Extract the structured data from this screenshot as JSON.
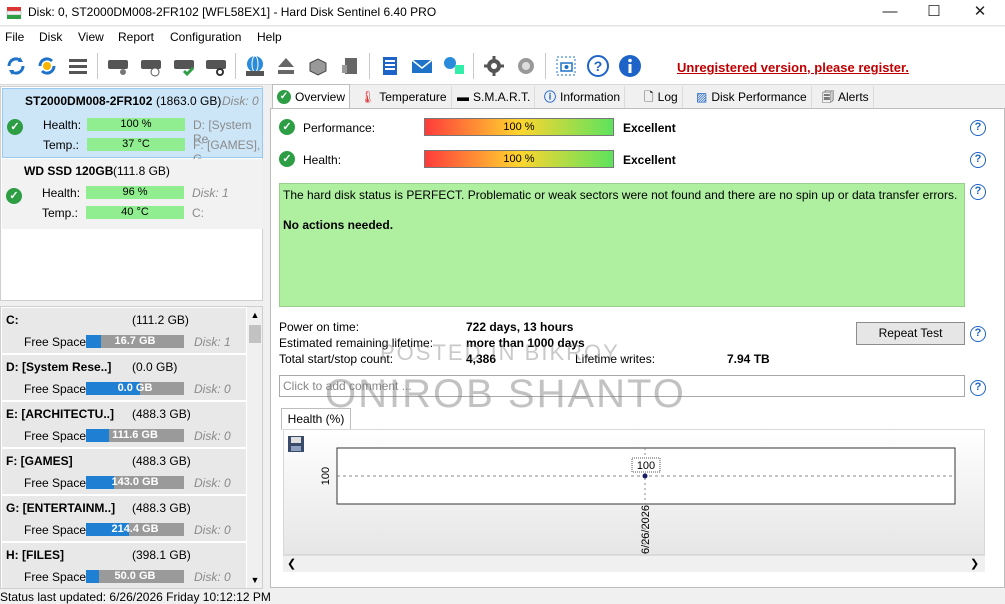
{
  "window": {
    "title": "Disk: 0, ST2000DM008-2FR102 [WFL58EX1]  -  Hard Disk Sentinel 6.40 PRO"
  },
  "menu": [
    "File",
    "Disk",
    "View",
    "Report",
    "Configuration",
    "Help"
  ],
  "toolbar": {
    "unregistered": "Unregistered version, please register."
  },
  "disks": [
    {
      "name": "ST2000DM008-2FR102",
      "size": "(1863.0 GB)",
      "disk": "Disk: 0",
      "health_label": "Health:",
      "health": "100 %",
      "temp_label": "Temp.:",
      "temp": "37 °C",
      "part1": "D: [System Re",
      "part2": "F: [GAMES], G"
    },
    {
      "name": "WD SSD 120GB",
      "size": "(111.8 GB)",
      "disk": "Disk: 1",
      "health_label": "Health:",
      "health": "96 %",
      "temp_label": "Temp.:",
      "temp": "40 °C",
      "part1": "C:"
    }
  ],
  "drives": [
    {
      "name": "C:",
      "size": "(111.2 GB)",
      "free_label": "Free Space",
      "free": "16.7 GB",
      "fill": 0.15,
      "disk": "Disk: 1"
    },
    {
      "name": "D: [System Rese..]",
      "size": "(0.0 GB)",
      "free_label": "Free Space",
      "free": "0.0 GB",
      "fill": 0.55,
      "disk": "Disk: 0"
    },
    {
      "name": "E: [ARCHITECTU..]",
      "size": "(488.3 GB)",
      "free_label": "Free Space",
      "free": "111.6 GB",
      "fill": 0.23,
      "disk": "Disk: 0"
    },
    {
      "name": "F: [GAMES]",
      "size": "(488.3 GB)",
      "free_label": "Free Space",
      "free": "143.0 GB",
      "fill": 0.29,
      "disk": "Disk: 0"
    },
    {
      "name": "G: [ENTERTAINM..]",
      "size": "(488.3 GB)",
      "free_label": "Free Space",
      "free": "214.4 GB",
      "fill": 0.44,
      "disk": "Disk: 0"
    },
    {
      "name": "H: [FILES]",
      "size": "(398.1 GB)",
      "free_label": "Free Space",
      "free": "50.0 GB",
      "fill": 0.13,
      "disk": "Disk: 0"
    }
  ],
  "tabs": [
    "Overview",
    "Temperature",
    "S.M.A.R.T.",
    "Information",
    "Log",
    "Disk Performance",
    "Alerts"
  ],
  "overview": {
    "performance_label": "Performance:",
    "performance": "100 %",
    "performance_rating": "Excellent",
    "health_label": "Health:",
    "health": "100 %",
    "health_rating": "Excellent",
    "status_text": "The hard disk status is PERFECT. Problematic or weak sectors were not found and there are no spin up or data transfer errors.",
    "status_action": "No actions needed.",
    "power_on_label": "Power on time:",
    "power_on": "722 days, 13 hours",
    "remaining_label": "Estimated remaining lifetime:",
    "remaining": "more than 1000 days",
    "startstop_label": "Total start/stop count:",
    "startstop": "4,386",
    "lifetime_label": "Lifetime writes:",
    "lifetime": "7.94 TB",
    "repeat_test": "Repeat Test",
    "comment_placeholder": "Click to add comment ..."
  },
  "health_tab": "Health (%)",
  "chart_data": {
    "type": "line",
    "x": [
      "6/26/2026"
    ],
    "series": [
      {
        "values": [
          100
        ]
      }
    ],
    "ylabel_tick": "100",
    "data_label": "100"
  },
  "watermark": {
    "line1": "POSTED IN BIKROY",
    "line2": "ONIROB SHANTO"
  },
  "statusbar": "Status last updated: 6/26/2026 Friday 10:12:12 PM"
}
